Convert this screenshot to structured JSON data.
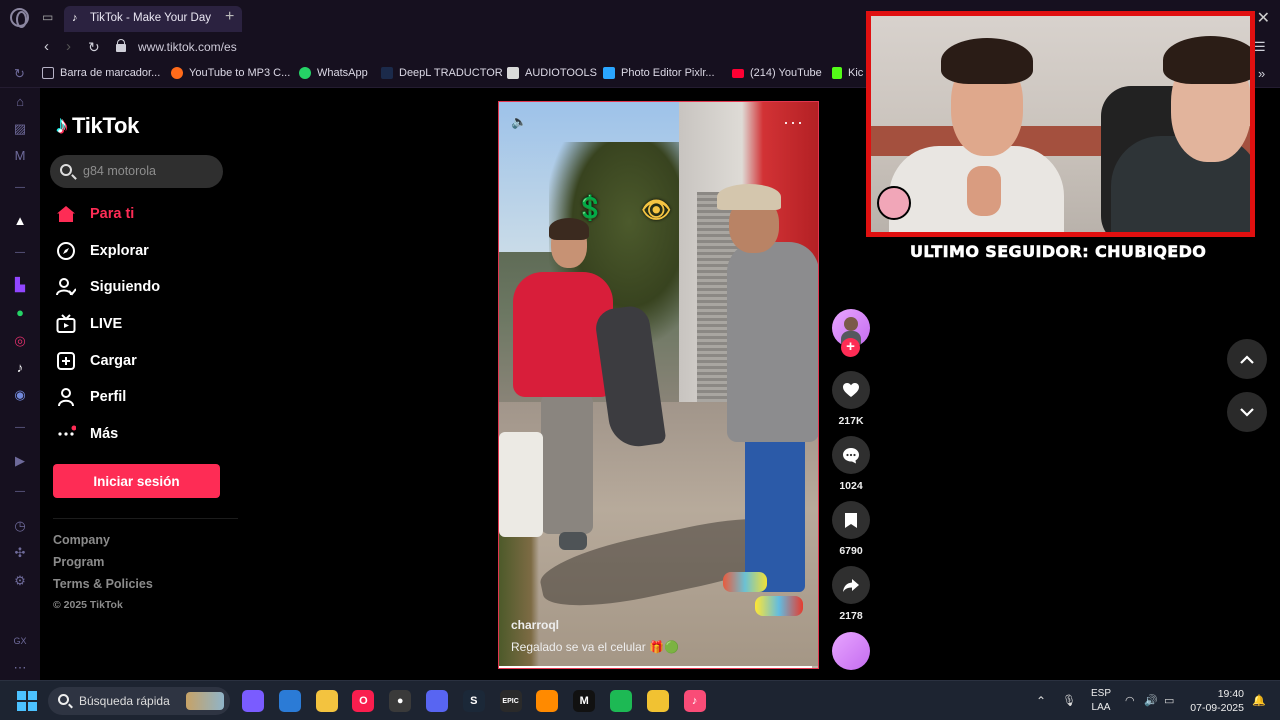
{
  "browser": {
    "tab_title": "TikTok - Make Your Day",
    "new_tab": "+",
    "url": "www.tiktok.com/es",
    "bookmarks": [
      {
        "label": "Barra de marcador...",
        "color": "#b6b2c6"
      },
      {
        "label": "YouTube to MP3 C...",
        "color": "#ff6a1a"
      },
      {
        "label": "WhatsApp",
        "color": "#25d366"
      },
      {
        "label": "DeepL TRADUCTOR",
        "color": "#7aa7ff"
      },
      {
        "label": "AUDIOTOOLS",
        "color": "#d9d9d9"
      },
      {
        "label": "Photo Editor Pixlr...",
        "color": "#2aa6ff"
      },
      {
        "label": "(214) YouTube",
        "color": "#ff0033"
      },
      {
        "label": "Kic",
        "color": "#53fc18"
      }
    ]
  },
  "tiktok": {
    "logo_text": "TikTok",
    "search_placeholder": "g84 motorola",
    "nav": [
      {
        "label": "Para ti",
        "icon": "home-icon",
        "active": true
      },
      {
        "label": "Explorar",
        "icon": "compass-icon"
      },
      {
        "label": "Siguiendo",
        "icon": "following-icon"
      },
      {
        "label": "LIVE",
        "icon": "live-tv-icon"
      },
      {
        "label": "Cargar",
        "icon": "upload-icon"
      },
      {
        "label": "Perfil",
        "icon": "profile-icon"
      },
      {
        "label": "Más",
        "icon": "more-icon"
      }
    ],
    "login_label": "Iniciar sesión",
    "footer": {
      "company": "Company",
      "program": "Program",
      "terms": "Terms & Policies",
      "copyright": "© 2025 TikTok"
    },
    "video": {
      "author": "charroql",
      "caption": "Regalado se va el celular 🎁🟢",
      "stickers": [
        "💲",
        "👁"
      ],
      "progress": 0.98
    },
    "actions": {
      "likes": "217K",
      "comments": "1024",
      "saves": "6790",
      "shares": "2178"
    }
  },
  "stream_overlay": {
    "label": "ULTIMO SEGUIDOR: CHUBIQEDO",
    "border_color": "#e01010"
  },
  "taskbar": {
    "search_text": "Búsqueda rápida",
    "apps": [
      {
        "name": "copilot-app",
        "color": "#7a5cff",
        "text": ""
      },
      {
        "name": "notepad-app",
        "color": "#2b7bd6",
        "text": ""
      },
      {
        "name": "file-explorer-app",
        "color": "#f3c33f",
        "text": ""
      },
      {
        "name": "opera-gx-app",
        "color": "#fa1e4e",
        "text": "O"
      },
      {
        "name": "obs-app",
        "color": "#3a3a3a",
        "text": "●"
      },
      {
        "name": "discord-app",
        "color": "#5865f2",
        "text": ""
      },
      {
        "name": "steam-app",
        "color": "#1b2838",
        "text": "S"
      },
      {
        "name": "epic-games-app",
        "color": "#2a2a2a",
        "text": "EPIC"
      },
      {
        "name": "fl-studio-app",
        "color": "#ff8a00",
        "text": ""
      },
      {
        "name": "capcut-app",
        "color": "#111",
        "text": "M"
      },
      {
        "name": "spotify-app",
        "color": "#1db954",
        "text": ""
      },
      {
        "name": "chrome-app",
        "color": "#f1c232",
        "text": ""
      },
      {
        "name": "itunes-app",
        "color": "#f94c77",
        "text": "♪"
      }
    ],
    "lang_top": "ESP",
    "lang_bottom": "LAA",
    "time": "19:40",
    "date": "07-09-2025"
  }
}
